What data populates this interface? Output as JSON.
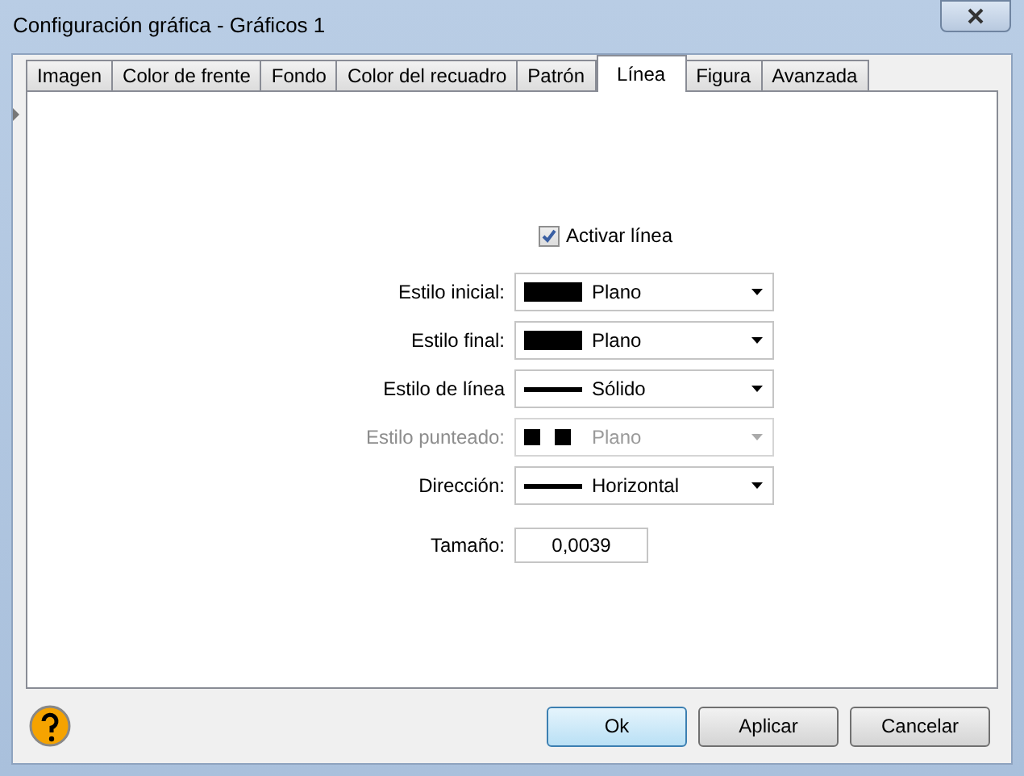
{
  "window": {
    "title": "Configuración gráfica - Gráficos 1"
  },
  "tabs": [
    {
      "label": "Imagen",
      "selected": false
    },
    {
      "label": "Color de frente",
      "selected": false
    },
    {
      "label": "Fondo",
      "selected": false
    },
    {
      "label": "Color del recuadro",
      "selected": false
    },
    {
      "label": "Patrón",
      "selected": false
    },
    {
      "label": "Línea",
      "selected": true
    },
    {
      "label": "Figura",
      "selected": false
    },
    {
      "label": "Avanzada",
      "selected": false
    }
  ],
  "activate": {
    "label": "Activar línea",
    "checked": true
  },
  "fields": [
    {
      "label": "Estilo inicial:",
      "value": "Plano",
      "kind": "block",
      "disabled": false
    },
    {
      "label": "Estilo final:",
      "value": "Plano",
      "kind": "block",
      "disabled": false
    },
    {
      "label": "Estilo de línea",
      "value": "Sólido",
      "kind": "line",
      "disabled": false
    },
    {
      "label": "Estilo punteado:",
      "value": "Plano",
      "kind": "dots",
      "disabled": true
    },
    {
      "label": "Dirección:",
      "value": "Horizontal",
      "kind": "line",
      "disabled": false
    }
  ],
  "size": {
    "label": "Tamaño:",
    "value": "0,0039"
  },
  "buttons": [
    {
      "label": "Ok",
      "default": true
    },
    {
      "label": "Aplicar",
      "default": false
    },
    {
      "label": "Cancelar",
      "default": false
    }
  ]
}
